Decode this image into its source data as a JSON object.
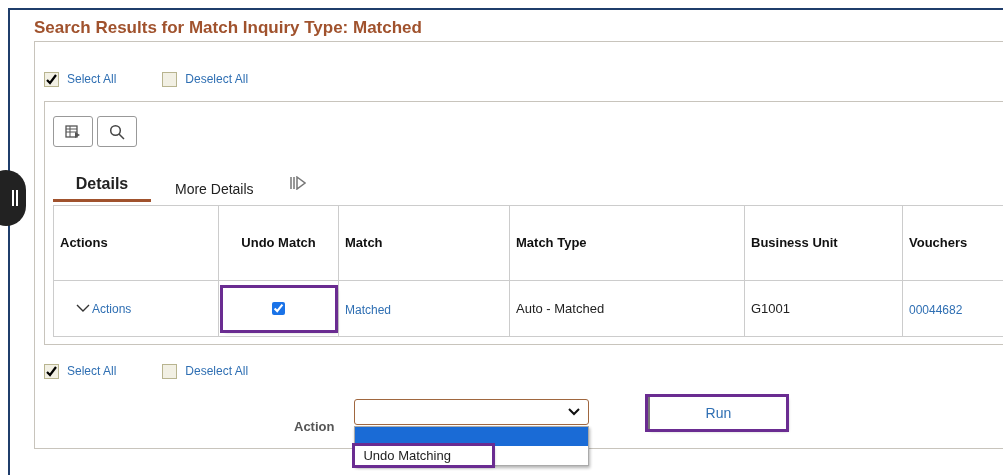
{
  "title": "Search Results for Match Inquiry Type: Matched",
  "select_top": [
    {
      "label": "Select All",
      "checked": true
    },
    {
      "label": "Deselect All",
      "checked": false
    }
  ],
  "tabs": [
    {
      "label": "Details",
      "selected": true
    },
    {
      "label": "More Details",
      "selected": false
    }
  ],
  "table": {
    "columns": [
      "Actions",
      "Undo Match",
      "Match",
      "Match Type",
      "Business Unit",
      "Vouchers"
    ],
    "rows": [
      {
        "actions": "Actions",
        "undo_match": true,
        "undo_highlighted": true,
        "match": "Matched",
        "match_type": "Auto - Matched",
        "business_unit": "G1001",
        "vouchers": "00044682"
      }
    ]
  },
  "select_bottom": [
    {
      "label": "Select All",
      "checked": true
    },
    {
      "label": "Deselect All",
      "checked": false
    }
  ],
  "action": {
    "label": "Action",
    "options": [
      {
        "selected": true,
        "highlighted": false
      },
      {
        "label": "Undo Matching",
        "selected": false,
        "highlighted": true
      }
    ]
  },
  "run": {
    "label": "Run",
    "highlighted": true
  }
}
